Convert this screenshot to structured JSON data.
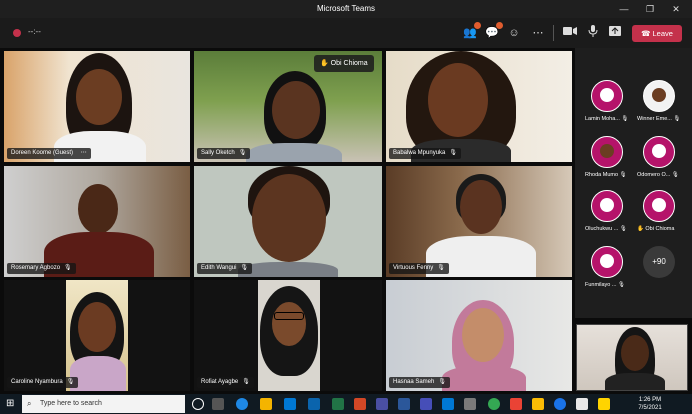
{
  "window": {
    "title": "Microsoft Teams",
    "minimize": "—",
    "restore": "❐",
    "close": "✕"
  },
  "toolbar": {
    "timer": "--:--",
    "leave_label": "Leave",
    "leave_color": "#c4314b",
    "icons": [
      "participants-icon",
      "chat-icon",
      "reactions-icon",
      "more-icon",
      "camera-icon",
      "mic-icon",
      "share-icon"
    ]
  },
  "tiles": [
    {
      "name": "Doreen Koome (Guest)",
      "extra": "⋯"
    },
    {
      "name": "Sally Oketch"
    },
    {
      "name": "Babalwa Mpunyuka"
    },
    {
      "name": "Rosemary Agbozo"
    },
    {
      "name": "Edith Wangui"
    },
    {
      "name": "Virtuous Fenny"
    },
    {
      "name": "Caroline Nyambura"
    },
    {
      "name": "Rofiat Ayagbe"
    },
    {
      "name": "Hasnaa Sameh"
    }
  ],
  "raised_hand": {
    "label": "Obi Chioma",
    "icon": "raised-hand-icon"
  },
  "roster": [
    {
      "name": "Lamin Moha...",
      "color": "#b5136a"
    },
    {
      "name": "Winner Eme...",
      "color": "#f2f2f2"
    },
    {
      "name": "Rhoda Mumo",
      "color": "#b5136a"
    },
    {
      "name": "Odomero O...",
      "color": "#b5136a"
    },
    {
      "name": "Oluchukwu ...",
      "color": "#b5136a"
    },
    {
      "name": "Obi Chioma",
      "color": "#b5136a",
      "hand": "✋"
    },
    {
      "name": "Funmilayo ...",
      "color": "#b5136a"
    }
  ],
  "more_count": "+90",
  "taskbar": {
    "search_placeholder": "Type here to search",
    "time": "1:26 PM",
    "date": "7/5/2021"
  }
}
